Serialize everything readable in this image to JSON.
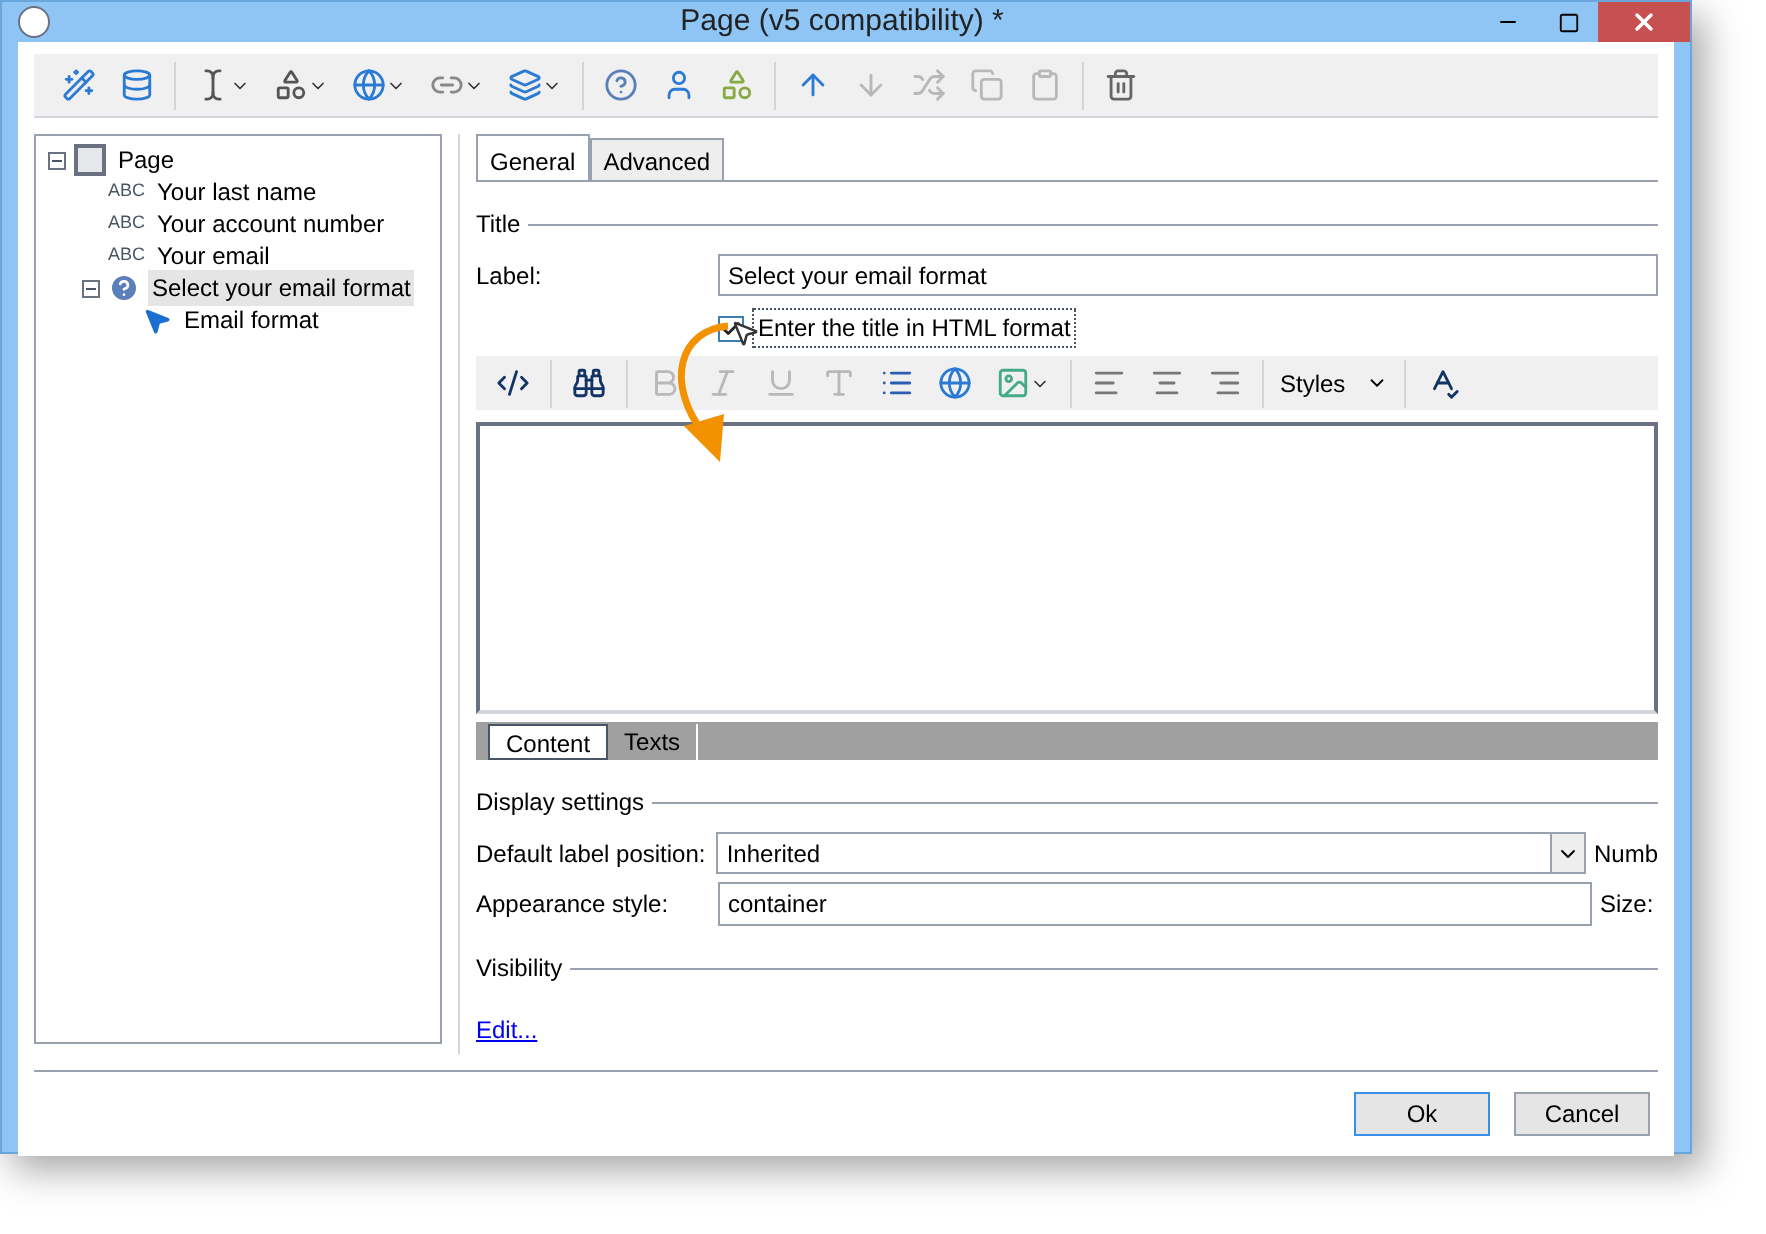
{
  "window": {
    "title": "Page (v5 compatibility) *"
  },
  "tree": {
    "items": [
      {
        "label": "Page",
        "kind": "page",
        "selected": false,
        "expanded": true,
        "children": [
          {
            "label": "Your last name",
            "kind": "text",
            "tag": "ABC",
            "selected": false
          },
          {
            "label": "Your account number",
            "kind": "text",
            "tag": "ABC",
            "selected": false
          },
          {
            "label": "Your email",
            "kind": "text",
            "tag": "ABC",
            "selected": false
          },
          {
            "label": "Select your email format",
            "kind": "question",
            "selected": true,
            "expanded": true,
            "children": [
              {
                "label": "Email format",
                "kind": "pointer",
                "selected": false
              }
            ]
          }
        ]
      }
    ]
  },
  "tabs": [
    {
      "label": "General",
      "selected": true
    },
    {
      "label": "Advanced",
      "selected": false
    }
  ],
  "title_section": {
    "heading": "Title",
    "label": "Label:",
    "value": "Select your email format",
    "html_checkbox": {
      "label": "Enter the title in HTML format",
      "checked": true
    }
  },
  "editor": {
    "styles": "Styles",
    "tabs": [
      {
        "label": "Content",
        "selected": true
      },
      {
        "label": "Texts",
        "selected": false
      }
    ]
  },
  "display_settings": {
    "heading": "Display settings",
    "label_position": {
      "label": "Default label position:",
      "value": "Inherited"
    },
    "appearance": {
      "label": "Appearance style:",
      "value": "container"
    },
    "numb": "Numb",
    "size": "Size:"
  },
  "visibility": {
    "heading": "Visibility",
    "link": "Edit..."
  },
  "buttons": [
    {
      "label": "Ok",
      "kind": "default"
    },
    {
      "label": "Cancel",
      "kind": "normal"
    }
  ]
}
